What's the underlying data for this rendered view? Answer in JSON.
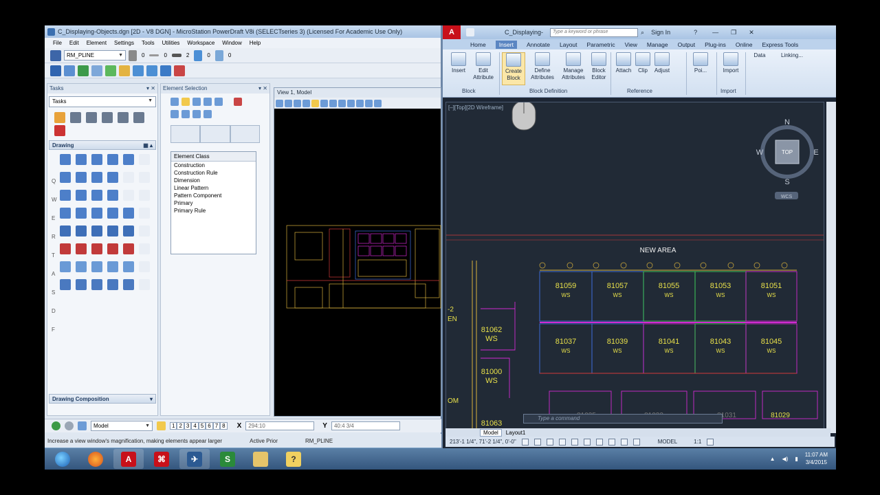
{
  "microstation": {
    "title": "C_Displaying-Objects.dgn [2D - V8 DGN] - MicroStation PowerDraft V8i (SELECTseries 3) (Licensed For Academic Use Only)",
    "menu": [
      "File",
      "Edit",
      "Element",
      "Settings",
      "Tools",
      "Utilities",
      "Workspace",
      "Window",
      "Help"
    ],
    "level_select": "RM_PLINE",
    "linestyle_value": "0",
    "weight_value": "0",
    "style_value": "2",
    "color_value": "0",
    "transparency_value": "0",
    "tasks_header": "Tasks",
    "tasks_select": "Tasks",
    "drawing_section": "Drawing",
    "drawing_composition": "Drawing Composition",
    "row_letters": [
      "Q",
      "W",
      "E",
      "R",
      "T",
      "A",
      "S",
      "D",
      "F"
    ],
    "element_selection_header": "Element Selection",
    "element_class_header": "Element Class",
    "element_classes": [
      "Construction",
      "Construction Rule",
      "Dimension",
      "Linear Pattern",
      "Pattern Component",
      "Primary",
      "Primary Rule"
    ],
    "view_title": "View 1, Model",
    "model_select": "Model",
    "view_numbers": [
      "1",
      "2",
      "3",
      "4",
      "5",
      "6",
      "7",
      "8"
    ],
    "x_label": "X",
    "x_value": "294:10",
    "y_label": "Y",
    "y_value": "40:4 3/4",
    "status_message": "Increase a view window's magnification, making elements appear larger",
    "active_prior": "Active Prior",
    "status_level": "RM_PLINE"
  },
  "autocad": {
    "title": "C_Displaying-",
    "search_placeholder": "Type a keyword or phrase",
    "sign_in": "Sign In",
    "tabs": [
      "Home",
      "Insert",
      "Annotate",
      "Layout",
      "Parametric",
      "View",
      "Manage",
      "Output",
      "Plug-ins",
      "Online",
      "Express Tools"
    ],
    "active_tab": "Insert",
    "ribbon_buttons": [
      {
        "label": "Insert"
      },
      {
        "label": "Edit Attribute"
      },
      {
        "label": "Create Block"
      },
      {
        "label": "Define Attributes"
      },
      {
        "label": "Manage Attributes"
      },
      {
        "label": "Block Editor"
      },
      {
        "label": "Attach"
      },
      {
        "label": "Clip"
      },
      {
        "label": "Adjust"
      },
      {
        "label": "Poi..."
      },
      {
        "label": "Import"
      },
      {
        "label": "Data"
      },
      {
        "label": "Linking..."
      }
    ],
    "groups": [
      "Block",
      "Block Definition",
      "Reference",
      "Import"
    ],
    "viewport_label": "[–][Top][2D Wireframe]",
    "viewcube": {
      "top": "TOP",
      "n": "N",
      "s": "S",
      "e": "E",
      "w": "W",
      "wcs": "WCS"
    },
    "new_area": "NEW AREA",
    "rooms_top": [
      "81059",
      "81057",
      "81055",
      "81053",
      "81051"
    ],
    "rooms_mid": [
      "81037",
      "81039",
      "81041",
      "81043",
      "81045"
    ],
    "rooms_bottom": [
      "81035",
      "81033",
      "81031",
      "81029"
    ],
    "left_rooms": [
      {
        "num": "81062",
        "type": "WS"
      },
      {
        "num": "81000",
        "type": "WS"
      },
      {
        "num": "81063",
        "type": ""
      }
    ],
    "ws_label": "WS",
    "left_fragments": [
      "-2",
      "EN",
      "OM"
    ],
    "command_placeholder": "Type a command",
    "layouts": [
      "Model",
      "Layout1"
    ],
    "coords": "213'-1 1/4\", 71'-2 1/4\", 0'-0\"",
    "model_label": "MODEL",
    "scale": "1:1"
  },
  "taskbar": {
    "time": "11:07 AM",
    "date": "3/4/2015"
  },
  "colors": {
    "autocad_bg": "#212a36",
    "ms_view_bg": "#000000",
    "room_line_blue": "#3f6fe0",
    "room_line_magenta": "#d12ad1",
    "text_yellow": "#e8e04a",
    "wall_red": "#d23a3a"
  }
}
